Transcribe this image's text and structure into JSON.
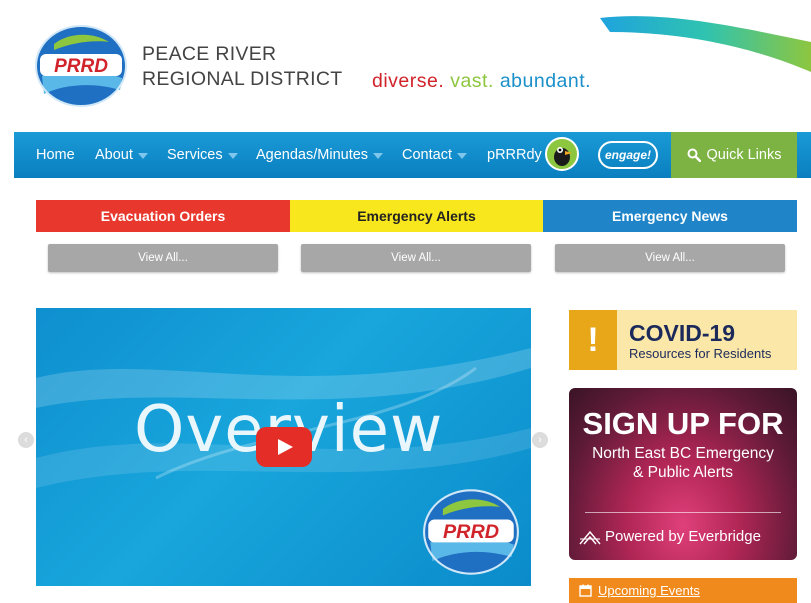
{
  "header": {
    "logo_text": "PRRD",
    "site_name_line1": "PEACE RIVER",
    "site_name_line2": "REGIONAL DISTRICT",
    "tagline": {
      "part1": "diverse.",
      "part2": "vast.",
      "part3": "abundant."
    }
  },
  "nav": {
    "items": [
      {
        "label": "Home"
      },
      {
        "label": "About"
      },
      {
        "label": "Services"
      },
      {
        "label": "Agendas/Minutes"
      },
      {
        "label": "Contact"
      },
      {
        "label": "pRRRdy"
      }
    ],
    "engage_label": "engage!",
    "quick_links_label": "Quick Links"
  },
  "alerts": {
    "tabs": [
      {
        "label": "Evacuation Orders"
      },
      {
        "label": "Emergency Alerts"
      },
      {
        "label": "Emergency News"
      }
    ],
    "view_all_label": "View All..."
  },
  "video": {
    "title": "Overview",
    "logo_text": "PRRD"
  },
  "covid_banner": {
    "mark": "!",
    "title": "COVID-19",
    "subtitle": "Resources for Residents"
  },
  "signup_banner": {
    "title": "SIGN UP FOR",
    "desc_line1": "North East BC Emergency",
    "desc_line2": "& Public Alerts",
    "powered_by": "Powered by Everbridge"
  },
  "events": {
    "label": "Upcoming Events"
  },
  "colors": {
    "nav_blue": "#0f8ccb",
    "quick_links_green": "#7cb342",
    "evac_red": "#e8382e",
    "alerts_yellow": "#f8e71c",
    "news_blue": "#1f85c8",
    "covid_amber": "#e7a718",
    "events_orange": "#f08a1c"
  }
}
